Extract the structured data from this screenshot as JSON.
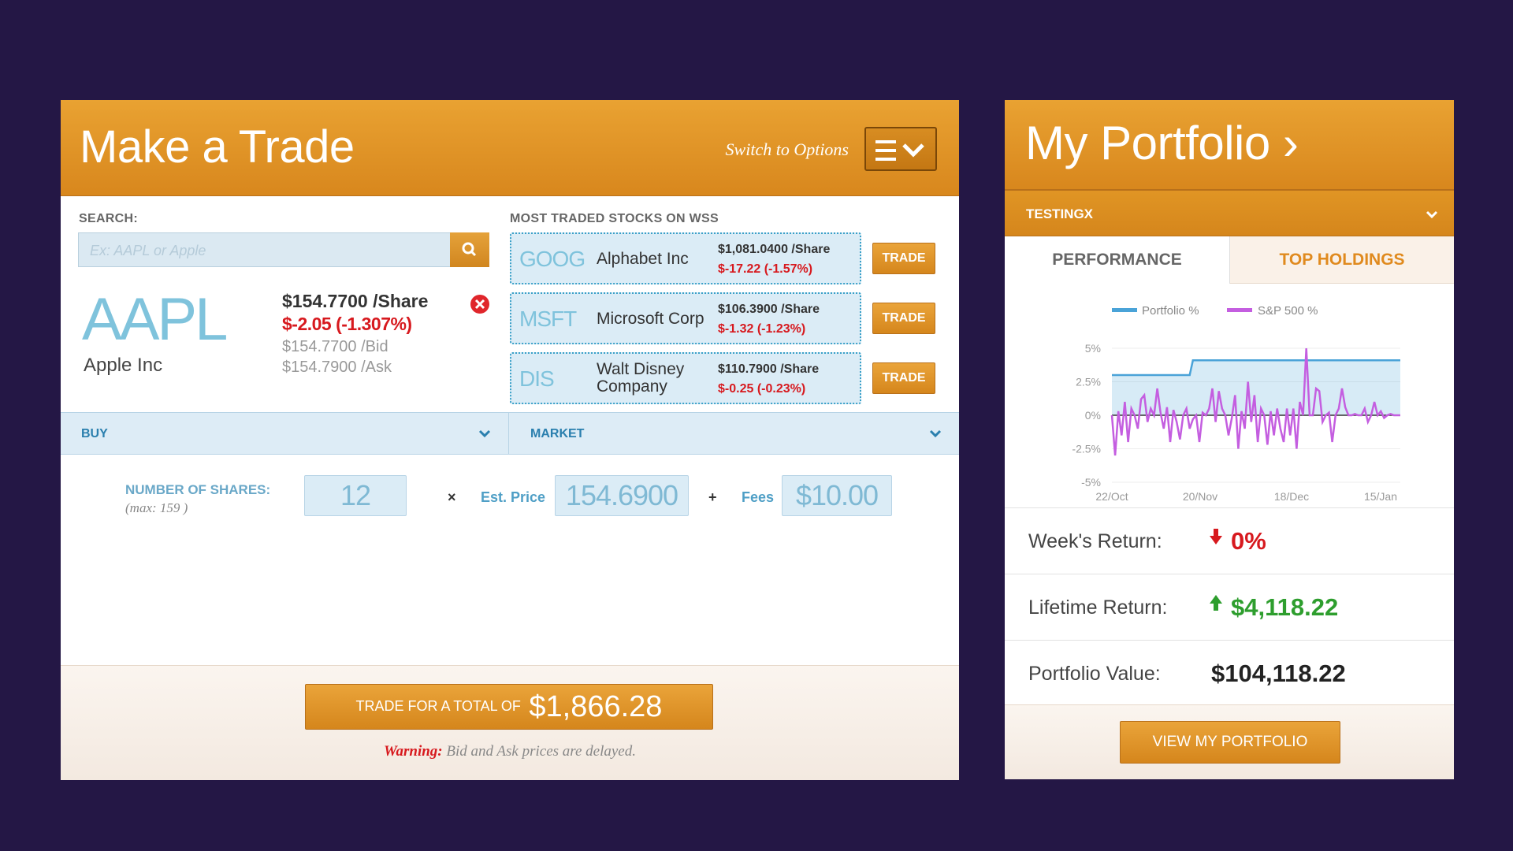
{
  "trade": {
    "title": "Make a Trade",
    "switch_label": "Switch to Options",
    "search_label": "SEARCH:",
    "search_placeholder": "Ex: AAPL or Apple",
    "selected": {
      "ticker": "AAPL",
      "company": "Apple Inc",
      "price": "$154.7700 /Share",
      "change": "$-2.05 (-1.307%)",
      "bid": "$154.7700 /Bid",
      "ask": "$154.7900 /Ask"
    },
    "most_traded_label": "MOST TRADED STOCKS ON WSS",
    "most_traded": [
      {
        "ticker": "GOOG",
        "name": "Alphabet Inc",
        "price": "$1,081.0400 /Share",
        "change": "$-17.22 (-1.57%)",
        "button": "TRADE"
      },
      {
        "ticker": "MSFT",
        "name": "Microsoft Corp",
        "price": "$106.3900 /Share",
        "change": "$-1.32 (-1.23%)",
        "button": "TRADE"
      },
      {
        "ticker": "DIS",
        "name": "Walt Disney Company",
        "price": "$110.7900 /Share",
        "change": "$-0.25 (-0.23%)",
        "button": "TRADE"
      }
    ],
    "action": "BUY",
    "order_type": "MARKET",
    "shares_label": "NUMBER OF SHARES:",
    "max_label": "(max: 159 )",
    "shares_value": "12",
    "times": "×",
    "est_price_label": "Est. Price",
    "est_price_value": "154.6900",
    "plus": "+",
    "fees_label": "Fees",
    "fees_value": "$10.00",
    "total_prefix": "TRADE FOR A TOTAL OF",
    "total_value": "$1,866.28",
    "warning_label": "Warning:",
    "warning_text": "Bid and Ask prices are delayed."
  },
  "portfolio": {
    "title": "My Portfolio ›",
    "account": "TESTINGX",
    "tabs": [
      "PERFORMANCE",
      "TOP HOLDINGS"
    ],
    "weeks_return_label": "Week's Return:",
    "weeks_return_value": "0%",
    "lifetime_return_label": "Lifetime Return:",
    "lifetime_return_value": "$4,118.22",
    "value_label": "Portfolio Value:",
    "value_value": "$104,118.22",
    "view_button": "VIEW MY PORTFOLIO"
  },
  "colors": {
    "accent": "#e09524",
    "negative": "#d7191e",
    "positive": "#2e9e2e",
    "portfolio_line": "#4aa3d8",
    "sp500_line": "#c45ee0"
  },
  "chart_data": {
    "type": "line",
    "x_ticks": [
      "22/Oct",
      "20/Nov",
      "18/Dec",
      "15/Jan"
    ],
    "y_ticks": [
      "5%",
      "2.5%",
      "0%",
      "-2.5%",
      "-5%"
    ],
    "ylim": [
      -5,
      5
    ],
    "legend_position": "top",
    "series": [
      {
        "name": "Portfolio %",
        "values": [
          3,
          3,
          3,
          3,
          3,
          3,
          3,
          3,
          3,
          3,
          3,
          3,
          3,
          3,
          3,
          3,
          3,
          3,
          3,
          3,
          3,
          3,
          3,
          3,
          3,
          4.1,
          4.1,
          4.1,
          4.1,
          4.1,
          4.1,
          4.1,
          4.1,
          4.1,
          4.1,
          4.1,
          4.1,
          4.1,
          4.1,
          4.1,
          4.1,
          4.1,
          4.1,
          4.1,
          4.1,
          4.1,
          4.1,
          4.1,
          4.1,
          4.1,
          4.1,
          4.1,
          4.1,
          4.1,
          4.1,
          4.1,
          4.1,
          4.1,
          4.1,
          4.1,
          4.1,
          4.1,
          4.1,
          4.1,
          4.1,
          4.1,
          4.1,
          4.1,
          4.1,
          4.1,
          4.1,
          4.1,
          4.1,
          4.1,
          4.1,
          4.1,
          4.1,
          4.1,
          4.1,
          4.1,
          4.1,
          4.1,
          4.1,
          4.1,
          4.1,
          4.1,
          4.1,
          4.1,
          4.1,
          4.1
        ]
      },
      {
        "name": "S&P 500 %",
        "values": [
          0,
          -3,
          0.3,
          -1.5,
          1,
          -2,
          0.5,
          0,
          -1,
          1.2,
          1.5,
          -0.5,
          0.5,
          0,
          2,
          0.2,
          -1,
          0.6,
          -2,
          0.4,
          -0.5,
          -1.8,
          0,
          0.5,
          -1,
          -0.3,
          0,
          -2,
          0.2,
          0,
          0.5,
          2,
          -0.5,
          1.8,
          0.5,
          0,
          -1.5,
          -0.2,
          1.5,
          -2.5,
          0.3,
          -1,
          2.5,
          -0.5,
          1.5,
          -2,
          0.5,
          0,
          -2.2,
          0.3,
          -1.5,
          0.5,
          -1,
          -2,
          0.5,
          -1.5,
          0.5,
          -2.5,
          1,
          0,
          5,
          0,
          0,
          2,
          1.8,
          -0.5,
          0,
          0.2,
          -2,
          0,
          0.5,
          2,
          0.6,
          0,
          0,
          0.1,
          0,
          0,
          0.5,
          -0.5,
          0,
          1,
          0,
          0.3,
          -0.2,
          0,
          0.1,
          0,
          0,
          0
        ]
      }
    ]
  }
}
